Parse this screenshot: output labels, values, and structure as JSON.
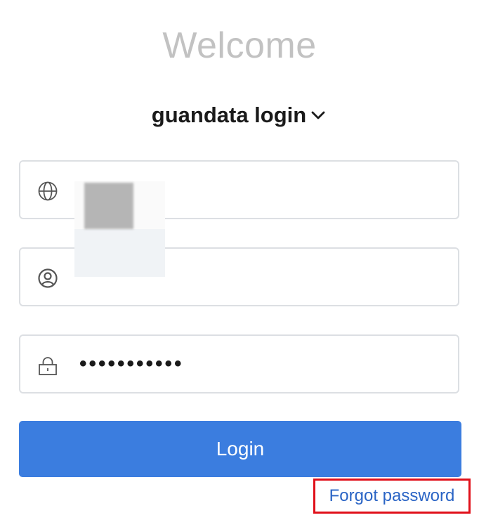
{
  "welcome_title": "Welcome",
  "login_type": {
    "label": "guandata login"
  },
  "fields": {
    "domain": {
      "value": "",
      "icon": "globe-icon"
    },
    "username": {
      "value": "",
      "icon": "user-circle-icon"
    },
    "password": {
      "value": "•••••••••••",
      "icon": "lock-icon"
    }
  },
  "login_button": {
    "label": "Login"
  },
  "forgot_password": {
    "label": "Forgot password"
  },
  "colors": {
    "primary": "#3b7ddf",
    "link": "#2a64c5",
    "highlight_box": "#e0101a",
    "muted_title": "#c2c2c2"
  }
}
